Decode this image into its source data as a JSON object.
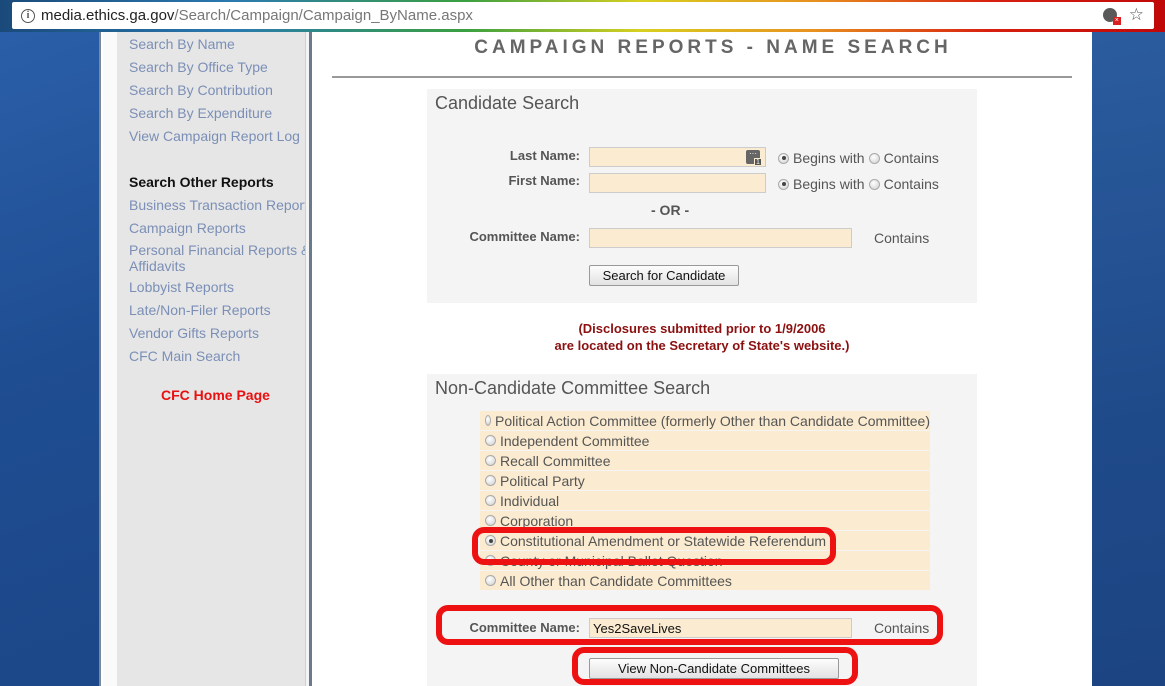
{
  "browser": {
    "url_host": "media.ethics.ga.gov",
    "url_path": "/Search/Campaign/Campaign_ByName.aspx",
    "icons": [
      "info-icon",
      "cookie-blocked-icon",
      "bookmark-star-icon"
    ]
  },
  "sidebar": {
    "campaign_links": [
      {
        "label": "Search By Name"
      },
      {
        "label": "Search By Office Type"
      },
      {
        "label": "Search By Contribution"
      },
      {
        "label": "Search By Expenditure"
      },
      {
        "label": "View Campaign Report Log"
      }
    ],
    "other_reports_header": "Search Other Reports",
    "other_links": [
      {
        "label": "Business Transaction Reports"
      },
      {
        "label": "Campaign Reports"
      },
      {
        "label": "Personal Financial Reports &"
      },
      {
        "label": "Affidavits"
      },
      {
        "label": "Lobbyist Reports"
      },
      {
        "label": "Late/Non-Filer Reports"
      },
      {
        "label": "Vendor Gifts Reports"
      },
      {
        "label": "CFC Main Search"
      }
    ],
    "home_link": "CFC Home Page"
  },
  "main": {
    "page_title": "CAMPAIGN REPORTS - NAME SEARCH",
    "candidate_search": {
      "title": "Candidate Search",
      "last_name_label": "Last Name:",
      "last_name_value": "",
      "first_name_label": "First Name:",
      "first_name_value": "",
      "begins_with_label": "Begins with",
      "contains_label": "Contains",
      "last_name_mode": "Begins with",
      "first_name_mode": "Begins with",
      "or_label": "- OR -",
      "committee_name_label": "Committee Name:",
      "committee_name_value": "",
      "committee_contains_label": "Contains",
      "search_button": "Search for Candidate"
    },
    "notice_line1": "(Disclosures submitted prior to 1/9/2006",
    "notice_line2": "are located on the Secretary of State's website.)",
    "non_candidate_search": {
      "title": "Non-Candidate Committee Search",
      "options": [
        {
          "label": "Political Action Committee (formerly Other than Candidate Committee)",
          "selected": false
        },
        {
          "label": "Independent Committee",
          "selected": false
        },
        {
          "label": "Recall Committee",
          "selected": false
        },
        {
          "label": "Political Party",
          "selected": false
        },
        {
          "label": "Individual",
          "selected": false
        },
        {
          "label": "Corporation",
          "selected": false
        },
        {
          "label": "Constitutional Amendment or Statewide Referendum",
          "selected": true
        },
        {
          "label": "County or Municipal Ballot Question",
          "selected": false
        },
        {
          "label": "All Other than Candidate Committees",
          "selected": false
        }
      ],
      "committee_name_label": "Committee Name:",
      "committee_name_value": "Yes2SaveLives",
      "contains_label": "Contains",
      "view_button": "View Non-Candidate Committees"
    }
  },
  "annotation_color": "#ee1111"
}
